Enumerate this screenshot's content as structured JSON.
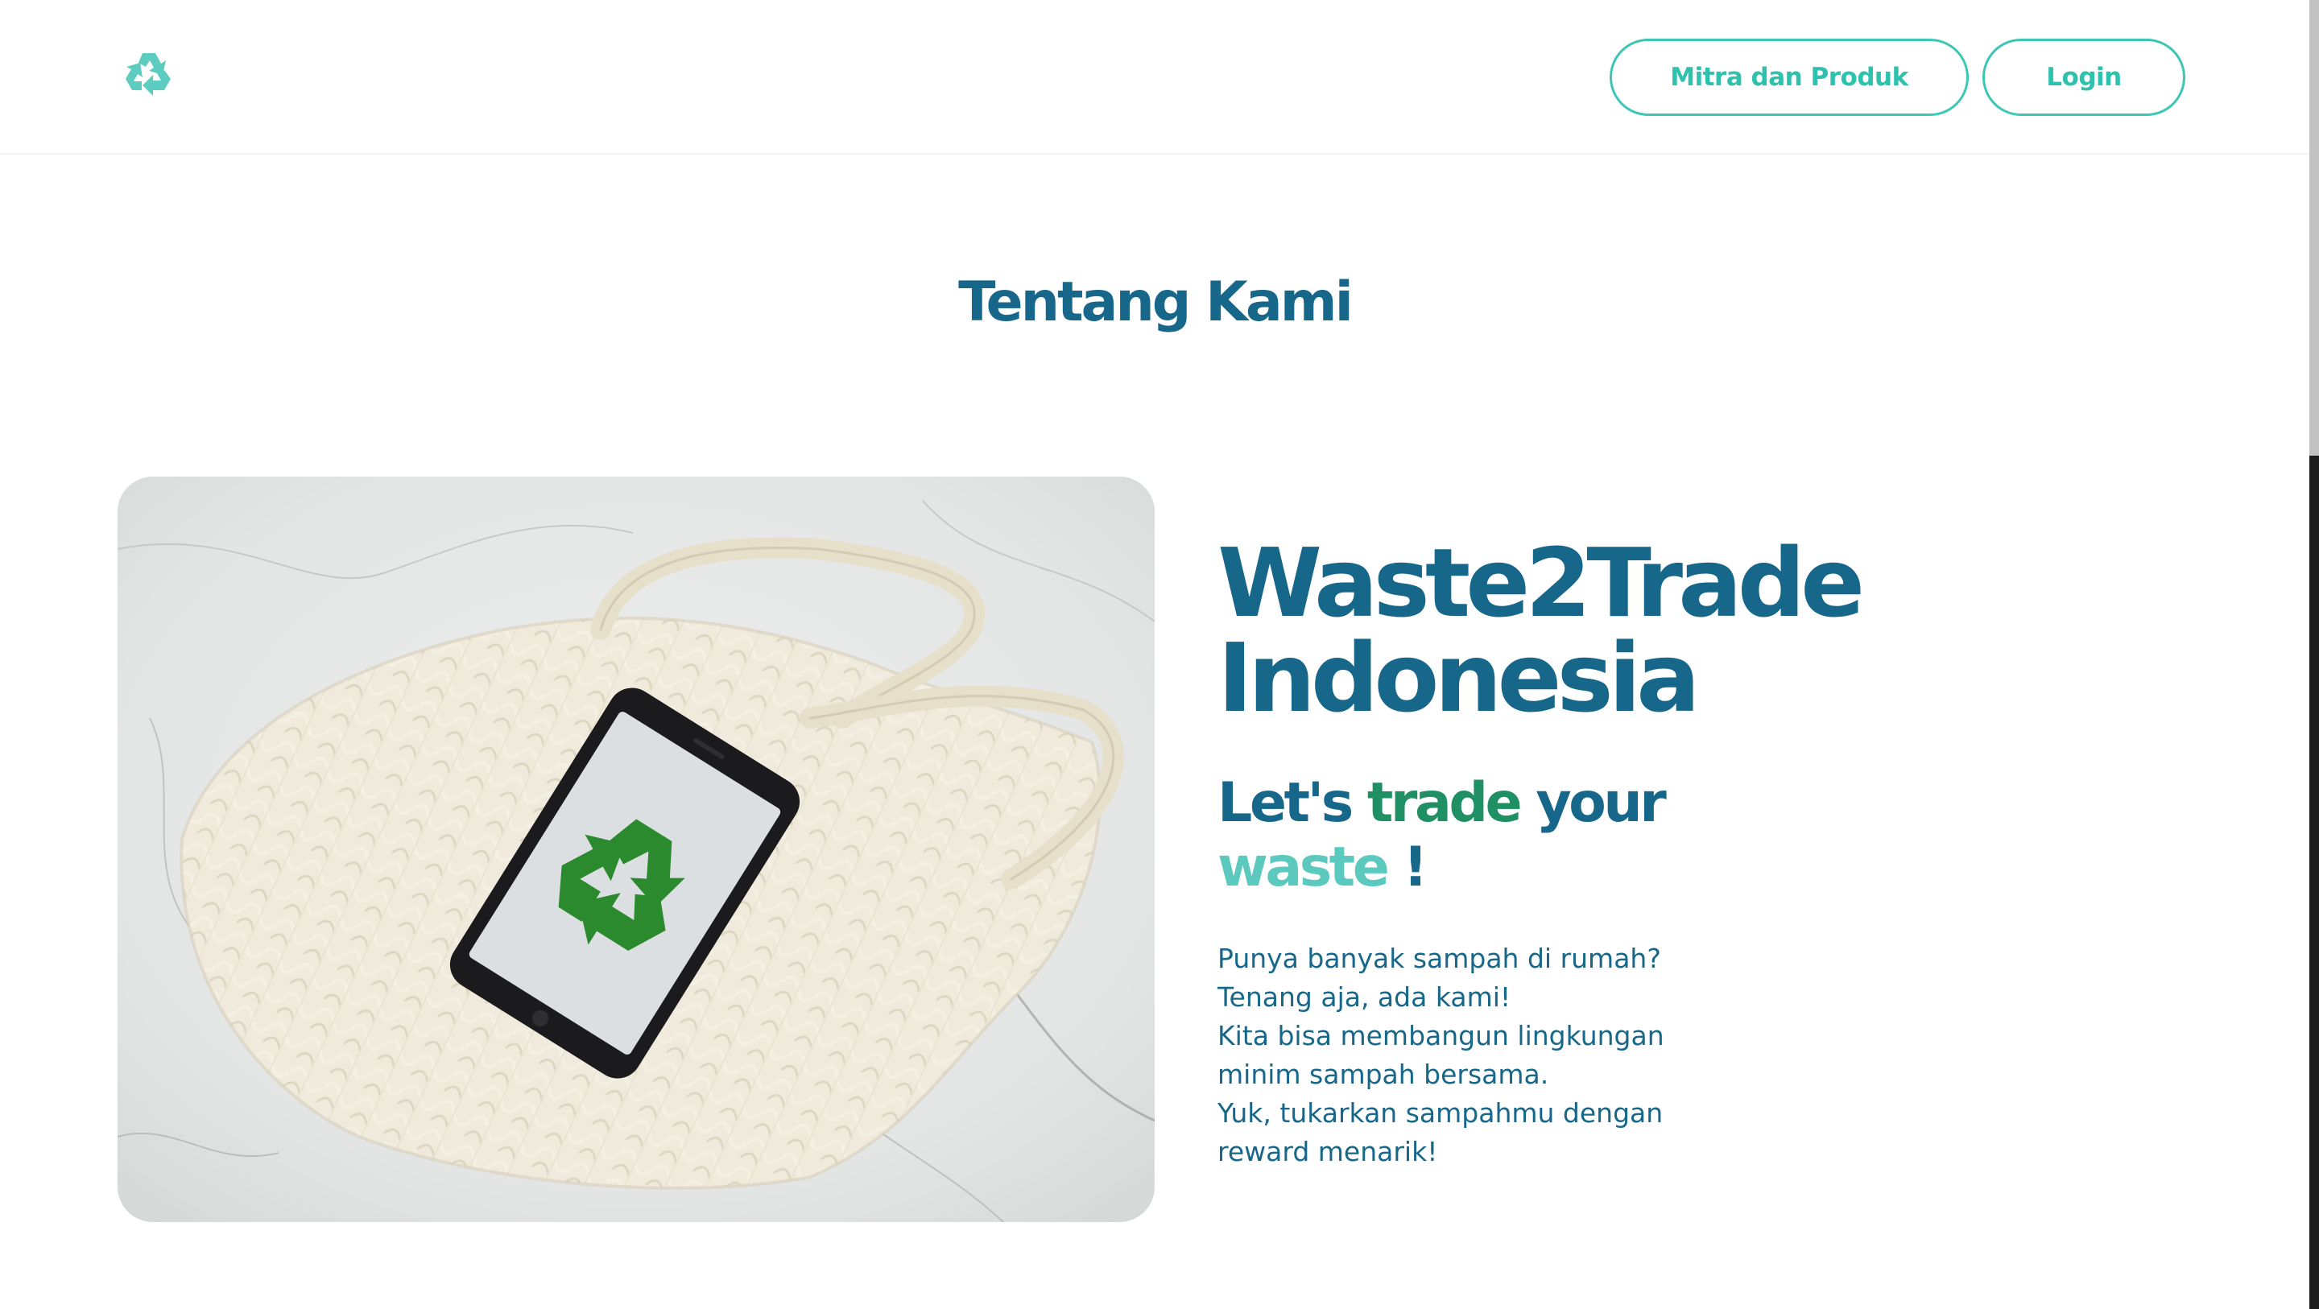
{
  "header": {
    "logo_icon": "recycle-icon",
    "nav": [
      {
        "label": "Mitra dan Produk"
      },
      {
        "label": "Login"
      }
    ]
  },
  "section": {
    "title": "Tentang Kami"
  },
  "about": {
    "image_icon": "phone-recycle-icon",
    "brand_line1": "Waste2Trade",
    "brand_line2": "Indonesia",
    "tagline": {
      "part1": "Let's ",
      "part2": "trade",
      "part3": " your",
      "part4": "waste",
      "part5": " !"
    },
    "description": [
      "Punya banyak sampah di rumah?",
      "Tenang aja, ada kami!",
      "Kita bisa membangun lingkungan",
      "minim sampah bersama.",
      "Yuk, tukarkan sampahmu dengan",
      "reward menarik!"
    ]
  },
  "colors": {
    "primary": "#17678a",
    "accent_teal": "#3cc6b4",
    "accent_green": "#1f8f64",
    "accent_light_teal": "#5bc9bd"
  }
}
